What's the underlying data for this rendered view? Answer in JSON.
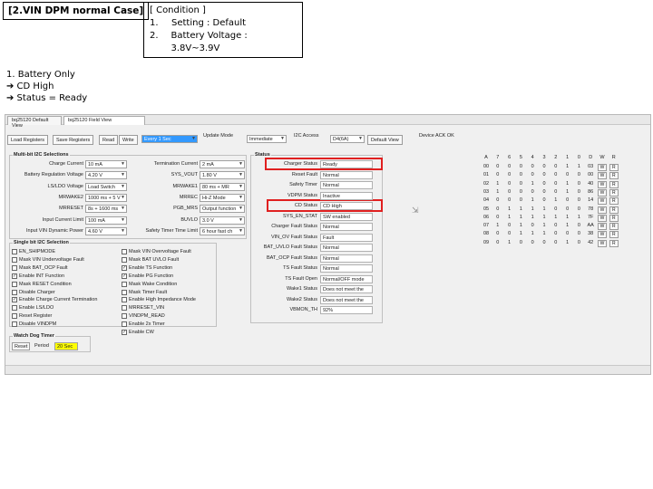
{
  "header": {
    "title": "[2.VIN DPM normal Case]",
    "condition_title": "[ Condition ]",
    "conditions": [
      {
        "num": "1.",
        "text": "Setting : Default"
      },
      {
        "num": "2.",
        "text": "Battery Voltage : 3.8V~3.9V"
      }
    ]
  },
  "notes": {
    "line1": "1. Battery Only",
    "line2": "➔ CD High",
    "line3": "➔ Status = Ready"
  },
  "app": {
    "tabs": [
      "bq25120 Default View",
      "bq25120 Field View"
    ],
    "toolbar": {
      "load_registers": "Load Registers",
      "save_registers": "Save Registers",
      "read": "Read",
      "write": "Write",
      "write_select": "Every 1 Sec",
      "update_mode_label": "Update Mode",
      "update_mode_value": "Immediate",
      "i2c_access_label": "I2C Access",
      "i2c_access_value": "D4(6A)",
      "default_view": "Default View",
      "device_ack": "Device ACK OK"
    },
    "multi_bit": {
      "title": "Multi-bit I2C Selections",
      "left": [
        {
          "label": "Charge Current",
          "value": "10 mA"
        },
        {
          "label": "Battery Regulation Voltage",
          "value": "4.20 V"
        },
        {
          "label": "LS/LDO Voltage",
          "value": "Load Switch"
        },
        {
          "label": "MRWAKE2",
          "value": "1000 ms + 5 V"
        },
        {
          "label": "MRRESET",
          "value": "8s + 1600 ms"
        },
        {
          "label": "Input Current Limit",
          "value": "100 mA"
        },
        {
          "label": "Input VIN Dynamic Power",
          "value": "4.60 V"
        }
      ],
      "right": [
        {
          "label": "Termination Current",
          "value": "2 mA"
        },
        {
          "label": "SYS_VOUT",
          "value": "1.80 V"
        },
        {
          "label": "MRWAKE1",
          "value": "80 ms + MR"
        },
        {
          "label": "MRREC",
          "value": "Hi-Z Mode"
        },
        {
          "label": "PGB_MRS",
          "value": "Output function"
        },
        {
          "label": "BUVLO",
          "value": "3.0 V"
        },
        {
          "label": "Safety Timer Time Limit",
          "value": "6 hour fast ch"
        }
      ]
    },
    "single_bit": {
      "title": "Single bit I2C Selection",
      "left": [
        {
          "label": "EN_SHIPMODE",
          "checked": false
        },
        {
          "label": "Mask VIN Undervoltage Fault",
          "checked": false
        },
        {
          "label": "Mask BAT_OCP Fault",
          "checked": false
        },
        {
          "label": "Enable INT Function",
          "checked": true
        },
        {
          "label": "Mask RESET Condition",
          "checked": false
        },
        {
          "label": "Disable Charger",
          "checked": false
        },
        {
          "label": "Enable Charge Current Termination",
          "checked": true
        },
        {
          "label": "Enable LS/LDO",
          "checked": false
        },
        {
          "label": "Reset Register",
          "checked": false
        },
        {
          "label": "Disable VINDPM",
          "checked": false
        }
      ],
      "right": [
        {
          "label": "Mask VIN Overvoltage Fault",
          "checked": false
        },
        {
          "label": "Mask BAT UVLO Fault",
          "checked": false
        },
        {
          "label": "Enable TS Function",
          "checked": true
        },
        {
          "label": "Enable PG Function",
          "checked": true
        },
        {
          "label": "Mask Wake Condition",
          "checked": false
        },
        {
          "label": "Mask Timer Fault",
          "checked": false
        },
        {
          "label": "Enable High Impedance Mode",
          "checked": false
        },
        {
          "label": "MRRESET_VIN",
          "checked": false
        },
        {
          "label": "VINDPM_READ",
          "checked": false
        },
        {
          "label": "Enable 2x Timer",
          "checked": false
        },
        {
          "label": "Enable CW",
          "checked": true
        }
      ]
    },
    "watchdog": {
      "title": "Watch Dog Timer",
      "reset": "Reset",
      "period_label": "Period",
      "period_value": "20 Sec"
    },
    "status": {
      "title": "Status",
      "rows": [
        {
          "label": "Charger Status",
          "value": "Ready"
        },
        {
          "label": "Reset Fault",
          "value": "Normal"
        },
        {
          "label": "Safety Timer",
          "value": "Normal"
        },
        {
          "label": "VDPM Status",
          "value": "Inactive"
        },
        {
          "label": "CD Status",
          "value": "CD High"
        },
        {
          "label": "SYS_EN_STAT",
          "value": "SW enabled"
        },
        {
          "label": "Charger Fault Status",
          "value": "Normal"
        },
        {
          "label": "VIN_OV Fault Status",
          "value": "Fault"
        },
        {
          "label": "BAT_UVLO Fault Status",
          "value": "Normal"
        },
        {
          "label": "BAT_OCP Fault Status",
          "value": "Normal"
        },
        {
          "label": "TS Fault Status",
          "value": "Normal"
        },
        {
          "label": "TS Fault Open",
          "value": "Normal/OFF mode"
        },
        {
          "label": "Wake1 Status",
          "value": "Does not meet the"
        },
        {
          "label": "Wake2 Status",
          "value": "Does not meet the"
        },
        {
          "label": "VBMON_TH",
          "value": "92%"
        }
      ]
    },
    "register_grid": {
      "headers": [
        "A",
        "7",
        "6",
        "5",
        "4",
        "3",
        "2",
        "1",
        "0",
        "D",
        "W",
        "R"
      ],
      "rows": [
        [
          "00",
          "0",
          "0",
          "0",
          "0",
          "0",
          "0",
          "1",
          "1",
          "03",
          "W",
          "R"
        ],
        [
          "01",
          "0",
          "0",
          "0",
          "0",
          "0",
          "0",
          "0",
          "0",
          "00",
          "W",
          "R"
        ],
        [
          "02",
          "1",
          "0",
          "0",
          "1",
          "0",
          "0",
          "1",
          "0",
          "40",
          "W",
          "R"
        ],
        [
          "03",
          "1",
          "0",
          "0",
          "0",
          "0",
          "0",
          "1",
          "0",
          "86",
          "W",
          "R"
        ],
        [
          "04",
          "0",
          "0",
          "0",
          "1",
          "0",
          "1",
          "0",
          "0",
          "14",
          "W",
          "R"
        ],
        [
          "05",
          "0",
          "1",
          "1",
          "1",
          "1",
          "0",
          "0",
          "0",
          "78",
          "W",
          "R"
        ],
        [
          "06",
          "0",
          "1",
          "1",
          "1",
          "1",
          "1",
          "1",
          "1",
          "7F",
          "W",
          "R"
        ],
        [
          "07",
          "1",
          "0",
          "1",
          "0",
          "1",
          "0",
          "1",
          "0",
          "AA",
          "W",
          "R"
        ],
        [
          "08",
          "0",
          "0",
          "1",
          "1",
          "1",
          "0",
          "0",
          "0",
          "38",
          "W",
          "R"
        ],
        [
          "09",
          "0",
          "1",
          "0",
          "0",
          "0",
          "0",
          "1",
          "0",
          "42",
          "W",
          "R"
        ]
      ]
    }
  },
  "colors": {
    "highlight_red": "#e02020",
    "select_blue": "#3399ff",
    "period_yellow": "#ffff00"
  }
}
